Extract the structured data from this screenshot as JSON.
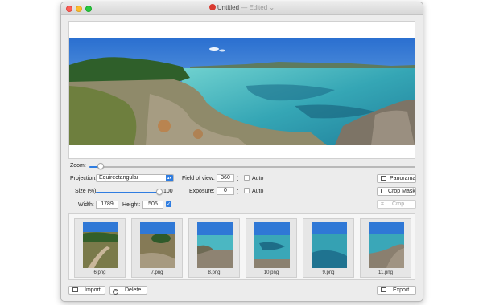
{
  "window": {
    "title": "Untitled",
    "title_suffix": "— Edited ⌄"
  },
  "controls": {
    "zoom_label": "Zoom:",
    "zoom_level": 0.04,
    "projection_label": "Projection:",
    "projection_value": "Equirectangular",
    "size_label": "Size (%):",
    "size_value": "100",
    "size_level": 1.0,
    "width_label": "Width:",
    "width_value": "1789",
    "height_label": "Height:",
    "height_value": "505",
    "fov_label": "Field of view:",
    "fov_value": "360",
    "fov_auto_label": "Auto",
    "exposure_label": "Exposure:",
    "exposure_value": "0",
    "exposure_auto_label": "Auto"
  },
  "side_buttons": {
    "panorama": "Panorama",
    "crop_mask": "Crop Mask",
    "crop": "Crop"
  },
  "thumbnails": [
    {
      "label": "6.png"
    },
    {
      "label": "7.png"
    },
    {
      "label": "8.png"
    },
    {
      "label": "10.png"
    },
    {
      "label": "9.png"
    },
    {
      "label": "11.png"
    }
  ],
  "bottom": {
    "import": "Import",
    "delete": "Delete",
    "export": "Export"
  },
  "colors": {
    "accent": "#2f7de1",
    "sky": "#3b7fd3",
    "sea": "#3aa7b8"
  }
}
